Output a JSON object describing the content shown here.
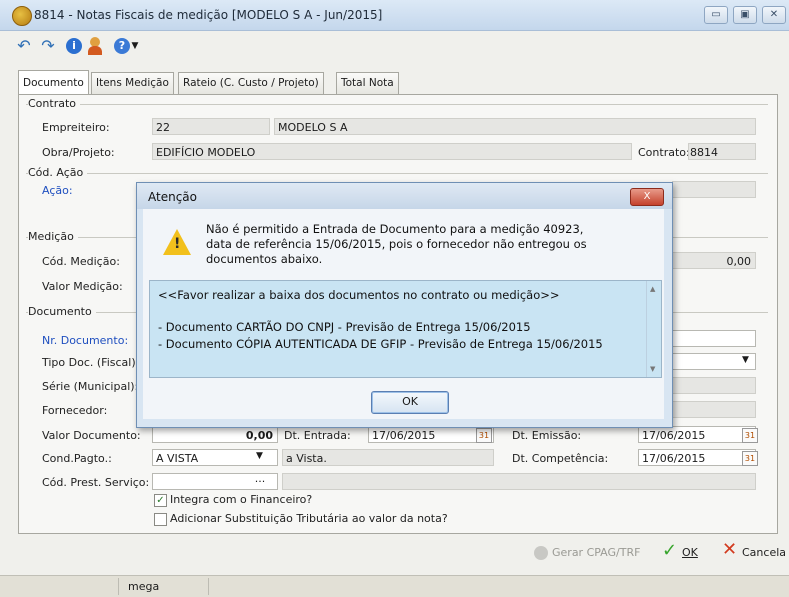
{
  "window": {
    "title": "8814 -  Notas Fiscais de medição [MODELO S A - Jun/2015]"
  },
  "tabs": [
    {
      "label": "Documento"
    },
    {
      "label": "Itens Medição"
    },
    {
      "label": "Rateio (C. Custo / Projeto)"
    },
    {
      "label": "Total Nota"
    }
  ],
  "contrato": {
    "group": "Contrato",
    "empreiteiro_label": "Empreiteiro:",
    "empreiteiro_code": "22",
    "empreiteiro_name": "MODELO S A",
    "obra_label": "Obra/Projeto:",
    "obra_value": "EDIFÍCIO MODELO",
    "contrato_label": "Contrato:",
    "contrato_value": "8814"
  },
  "acao": {
    "group": "Cód. Ação",
    "label": "Ação:"
  },
  "medicao": {
    "group": "Medição",
    "cod_label": "Cód. Medição:",
    "valor_label": "Valor Medição:",
    "valor_value": "0,00"
  },
  "documento": {
    "group": "Documento",
    "nr_label": "Nr. Documento:",
    "tipo_label": "Tipo Doc. (Fiscal):",
    "serie_label": "Série (Municipal):",
    "fornecedor_label": "Fornecedor:",
    "valor_label": "Valor Documento:",
    "valor_value": "0,00",
    "dt_entrada_label": "Dt. Entrada:",
    "dt_entrada_value": "17/06/2015",
    "dt_emissao_label": "Dt. Emissão:",
    "dt_emissao_value": "17/06/2015",
    "cond_label": "Cond.Pagto.:",
    "cond_value": "A VISTA",
    "cond_desc": "a Vista.",
    "dt_comp_label": "Dt. Competência:",
    "dt_comp_value": "17/06/2015",
    "cod_prest_label": "Cód. Prest. Serviço:",
    "cod_prest_btn": "...",
    "integra_label": "Integra com o Financeiro?",
    "substituicao_label": "Adicionar Substituição Tributária ao valor da nota?"
  },
  "footer": {
    "gerar": "Gerar CPAG/TRF",
    "ok": "OK",
    "cancela": "Cancela"
  },
  "status": {
    "user": "mega"
  },
  "dialog": {
    "title": "Atenção",
    "close": "X",
    "message": [
      "Não é permitido a Entrada de Documento para a medição 40923,",
      "data de referência 15/06/2015, pois o fornecedor não entregou os",
      "documentos abaixo."
    ],
    "memo": [
      "<<Favor realizar a baixa dos documentos no contrato ou medição>>",
      "- Documento CARTÃO DO CNPJ - Previsão de Entrega 15/06/2015",
      "- Documento CÓPIA AUTENTICADA DE GFIP - Previsão de Entrega 15/06/2015"
    ],
    "ok": "OK"
  },
  "colors": {
    "link": "#1f4fbf",
    "memo_bg": "#c9e4f3",
    "warning": "#f2c01c",
    "ok_green": "#37a52c",
    "cancel_red": "#d23a1e"
  },
  "icons": [
    "undo-icon",
    "redo-icon",
    "info-icon",
    "user-icon",
    "help-icon",
    "calendar-icon",
    "warning-icon",
    "ok-check-icon",
    "cancel-x-icon"
  ]
}
